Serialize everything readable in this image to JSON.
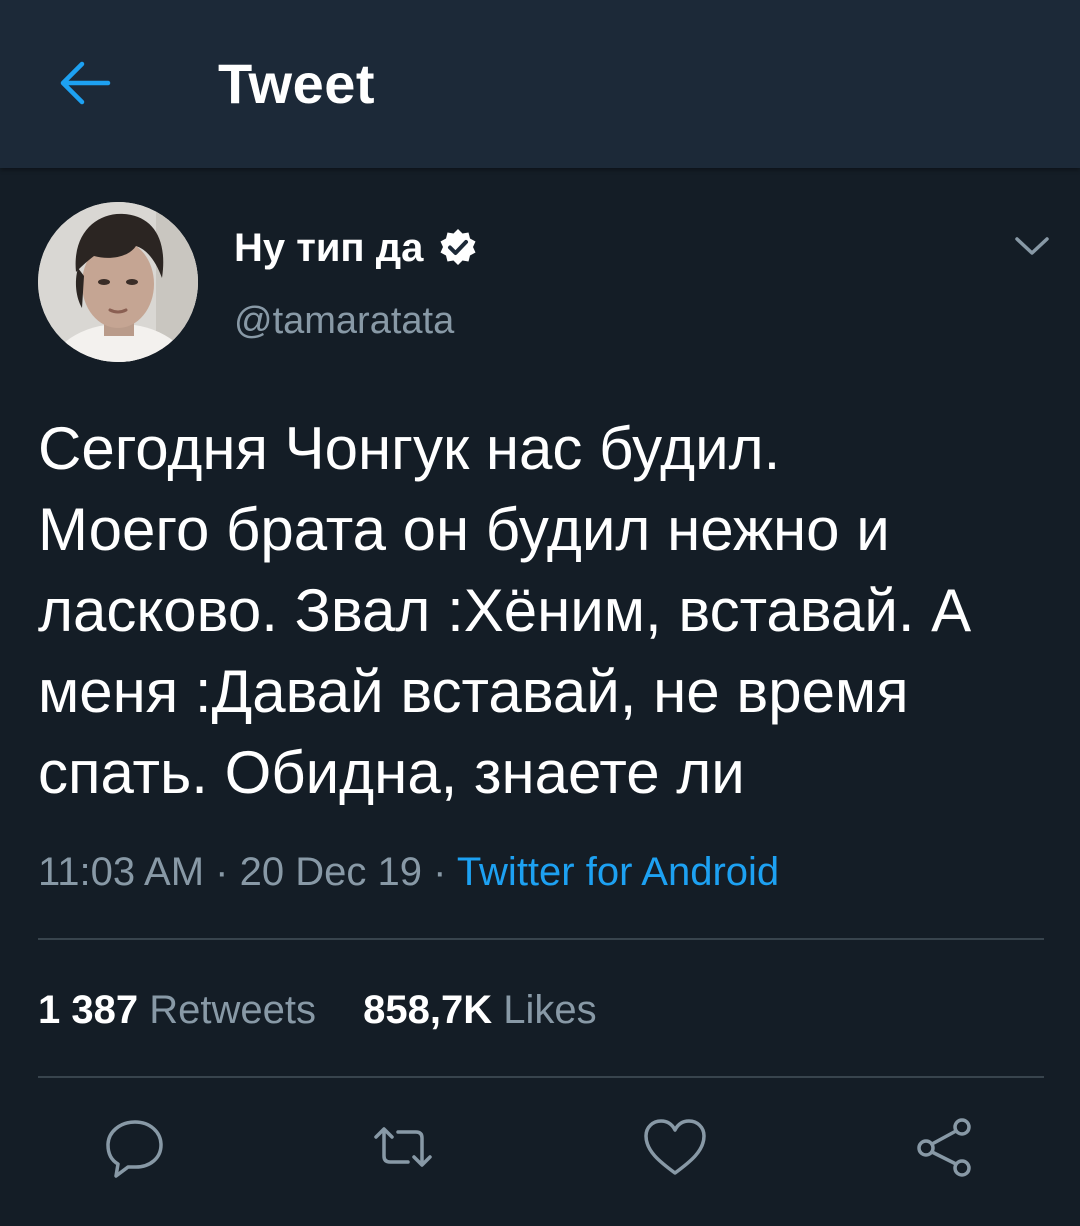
{
  "header": {
    "title": "Tweet",
    "back_icon": "arrow-left-icon"
  },
  "tweet": {
    "author": {
      "display_name": "Ну тип да",
      "handle": "@tamaratata",
      "verified": true
    },
    "text": "Сегодня Чонгук нас будил.\nМоего брата он будил нежно и ласково. Звал :Хёним, вставай. А меня :Давай вставай, не время спать. Обидна, знаете ли",
    "time": "11:03 AM",
    "separator": "·",
    "date": "20 Dec 19",
    "source": "Twitter for Android",
    "stats": {
      "retweets_count": "1 387",
      "retweets_label": "Retweets",
      "likes_count": "858,7K",
      "likes_label": "Likes"
    }
  },
  "actions": [
    "reply-icon",
    "retweet-icon",
    "like-icon",
    "share-icon"
  ],
  "colors": {
    "background": "#141d26",
    "header": "#1c2938",
    "accent": "#1da1f2",
    "secondary_text": "#8899a6",
    "divider": "#38444d"
  }
}
